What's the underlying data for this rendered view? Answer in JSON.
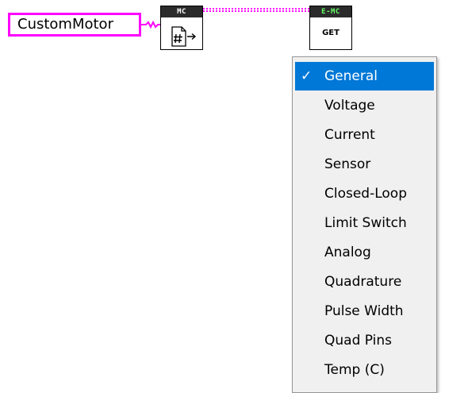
{
  "constant": {
    "value": "CustomMotor",
    "color": "#ff00ff"
  },
  "nodes": {
    "mc": {
      "banner": "MC",
      "icon": "number-to-string-icon"
    },
    "emc": {
      "banner": "E-MC",
      "label": "GET",
      "banner_text_color": "#66ff66"
    }
  },
  "wire_color": "#ff00ff",
  "menu": {
    "selected_index": 0,
    "selected_color": "#0078d7",
    "items": [
      {
        "label": "General",
        "checked": true
      },
      {
        "label": "Voltage",
        "checked": false
      },
      {
        "label": "Current",
        "checked": false
      },
      {
        "label": "Sensor",
        "checked": false
      },
      {
        "label": "Closed-Loop",
        "checked": false
      },
      {
        "label": "Limit Switch",
        "checked": false
      },
      {
        "label": "Analog",
        "checked": false
      },
      {
        "label": "Quadrature",
        "checked": false
      },
      {
        "label": "Pulse Width",
        "checked": false
      },
      {
        "label": "Quad Pins",
        "checked": false
      },
      {
        "label": "Temp (C)",
        "checked": false
      }
    ]
  }
}
